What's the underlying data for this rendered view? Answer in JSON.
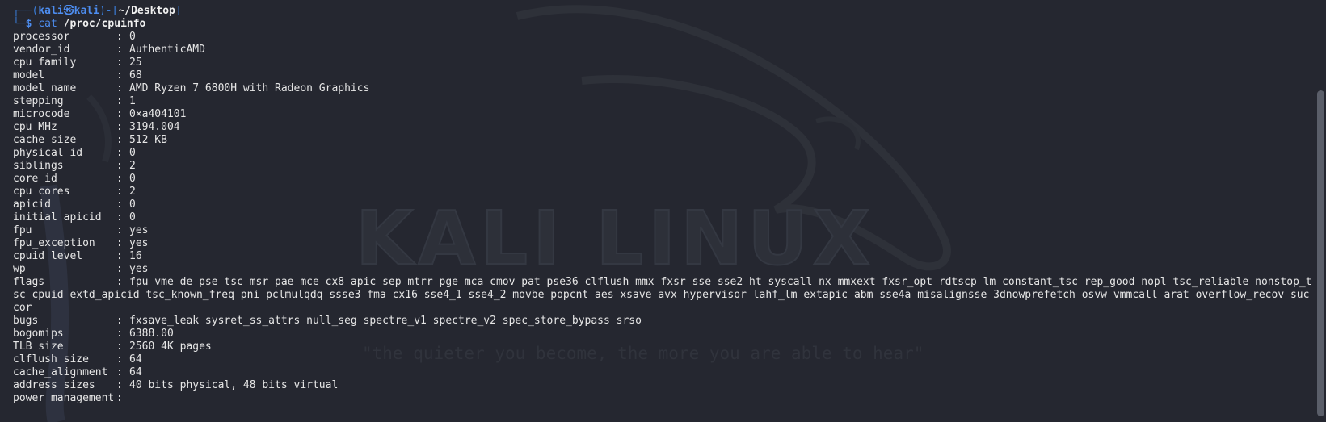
{
  "prompt": {
    "frame_top": "┌──(",
    "user": "kali",
    "at": "㉿",
    "host": "kali",
    "frame_mid": ")-[",
    "path": "~/Desktop",
    "frame_end": "]",
    "frame_bottom": "└─",
    "dollar": "$",
    "command": "cat",
    "argument": "/proc/cpuinfo"
  },
  "cpuinfo": [
    {
      "key": "processor",
      "value": "0"
    },
    {
      "key": "vendor_id",
      "value": "AuthenticAMD"
    },
    {
      "key": "cpu family",
      "value": "25"
    },
    {
      "key": "model",
      "value": "68"
    },
    {
      "key": "model name",
      "value": "AMD Ryzen 7 6800H with Radeon Graphics"
    },
    {
      "key": "stepping",
      "value": "1"
    },
    {
      "key": "microcode",
      "value": "0×a404101"
    },
    {
      "key": "cpu MHz",
      "value": "3194.004"
    },
    {
      "key": "cache size",
      "value": "512 KB"
    },
    {
      "key": "physical id",
      "value": "0"
    },
    {
      "key": "siblings",
      "value": "2"
    },
    {
      "key": "core id",
      "value": "0"
    },
    {
      "key": "cpu cores",
      "value": "2"
    },
    {
      "key": "apicid",
      "value": "0"
    },
    {
      "key": "initial apicid",
      "value": "0"
    },
    {
      "key": "fpu",
      "value": "yes"
    },
    {
      "key": "fpu_exception",
      "value": "yes"
    },
    {
      "key": "cpuid level",
      "value": "16"
    },
    {
      "key": "wp",
      "value": "yes"
    },
    {
      "key": "flags",
      "value": "fpu vme de pse tsc msr pae mce cx8 apic sep mtrr pge mca cmov pat pse36 clflush mmx fxsr sse sse2 ht syscall nx mmxext fxsr_opt rdtscp lm constant_tsc rep_good nopl tsc_reliable nonstop_tsc cpuid extd_apicid tsc_known_freq pni pclmulqdq ssse3 fma cx16 sse4_1 sse4_2 movbe popcnt aes xsave avx hypervisor lahf_lm extapic abm sse4a misalignsse 3dnowprefetch osvw vmmcall arat overflow_recov succor"
    },
    {
      "key": "bugs",
      "value": "fxsave_leak sysret_ss_attrs null_seg spectre_v1 spectre_v2 spec_store_bypass srso"
    },
    {
      "key": "bogomips",
      "value": "6388.00"
    },
    {
      "key": "TLB size",
      "value": "2560 4K pages"
    },
    {
      "key": "clflush size",
      "value": "64"
    },
    {
      "key": "cache_alignment",
      "value": "64"
    },
    {
      "key": "address sizes",
      "value": "40 bits physical, 48 bits virtual"
    },
    {
      "key": "power management",
      "value": ""
    }
  ],
  "wallpaper": {
    "title": "KALI LINUX",
    "tagline": "\"the quieter you become, the more you are able to hear\""
  },
  "colors": {
    "background": "#252730",
    "prompt_blue": "#4d8df0",
    "text": "#e6e6e6"
  }
}
